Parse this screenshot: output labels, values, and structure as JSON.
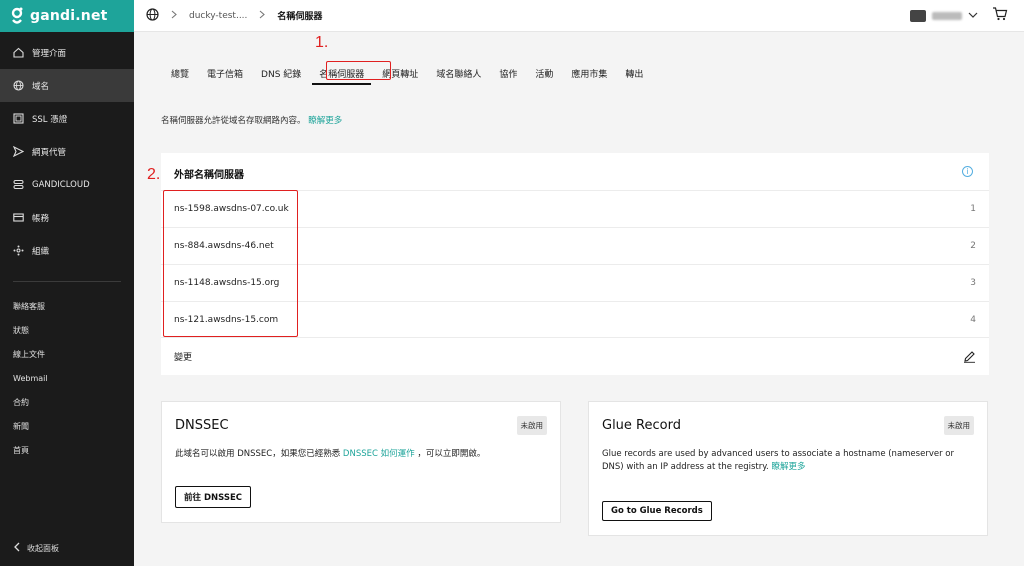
{
  "brand": {
    "name": "gandi.net",
    "color": "#1ea49a"
  },
  "sidebar": {
    "items": [
      {
        "icon": "home-icon",
        "label": "管理介面"
      },
      {
        "icon": "globe-icon",
        "label": "域名"
      },
      {
        "icon": "certificate-icon",
        "label": "SSL 憑證"
      },
      {
        "icon": "send-icon",
        "label": "網頁代管"
      },
      {
        "icon": "cloud-stack-icon",
        "label": "GANDICLOUD"
      },
      {
        "icon": "card-icon",
        "label": "帳務"
      },
      {
        "icon": "organization-icon",
        "label": "組織"
      }
    ],
    "links": [
      "聯絡客服",
      "狀態",
      "線上文件",
      "Webmail",
      "合約",
      "新聞",
      "首頁"
    ],
    "collapse_label": "收起面板"
  },
  "header": {
    "breadcrumbs": [
      "ducky-test....",
      "名稱伺服器"
    ]
  },
  "tabs": [
    "總覽",
    "電子信箱",
    "DNS 紀錄",
    "名稱伺服器",
    "網頁轉址",
    "域名聯絡人",
    "協作",
    "活動",
    "應用市集",
    "轉出"
  ],
  "active_tab": "名稱伺服器",
  "annotations": {
    "step1": "1.",
    "step2": "2."
  },
  "intro": {
    "text": "名稱伺服器允許從域名存取網路內容。",
    "link": "瞭解更多"
  },
  "nameservers": {
    "title": "外部名稱伺服器",
    "rows": [
      {
        "host": "ns-1598.awsdns-07.co.uk",
        "index": "1"
      },
      {
        "host": "ns-884.awsdns-46.net",
        "index": "2"
      },
      {
        "host": "ns-1148.awsdns-15.org",
        "index": "3"
      },
      {
        "host": "ns-121.awsdns-15.com",
        "index": "4"
      }
    ],
    "change_label": "變更"
  },
  "dnssec": {
    "title": "DNSSEC",
    "badge": "未啟用",
    "text_before": "此域名可以啟用 DNSSEC，如果您已經熟悉",
    "link": "DNSSEC 如何運作",
    "text_after": "，可以立即開啟。",
    "button": "前往 DNSSEC"
  },
  "glue": {
    "title": "Glue Record",
    "badge": "未啟用",
    "text": "Glue records are used by advanced users to associate a hostname (nameserver or DNS) with an IP address at the registry.",
    "link": "瞭解更多",
    "button": "Go to Glue Records"
  }
}
